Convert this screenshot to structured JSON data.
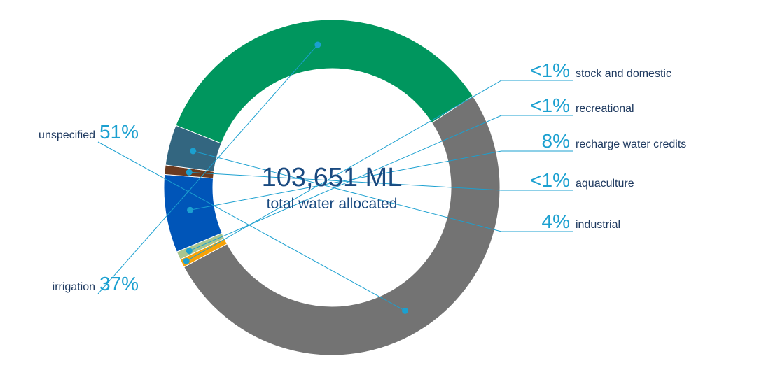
{
  "chart_data": {
    "type": "pie",
    "variant": "donut",
    "center_value": "103,651 ML",
    "center_caption": "total water allocated",
    "slices": [
      {
        "name": "unspecified",
        "percent_label": "51%",
        "value": 51.3,
        "color": "#737373"
      },
      {
        "name": "stock and domestic",
        "percent_label": "<1%",
        "value": 0.8,
        "color": "#f5a20a"
      },
      {
        "name": "recreational",
        "percent_label": "<1%",
        "value": 0.8,
        "color": "#a9c58f"
      },
      {
        "name": "recharge water credits",
        "percent_label": "8%",
        "value": 7.5,
        "color": "#0055b8"
      },
      {
        "name": "aquaculture",
        "percent_label": "<1%",
        "value": 0.9,
        "color": "#6b3a1f"
      },
      {
        "name": "industrial",
        "percent_label": "4%",
        "value": 3.9,
        "color": "#336680"
      },
      {
        "name": "irrigation",
        "percent_label": "37%",
        "value": 34.8,
        "color": "#00965e"
      }
    ],
    "leader_color": "#1ba0d0"
  }
}
